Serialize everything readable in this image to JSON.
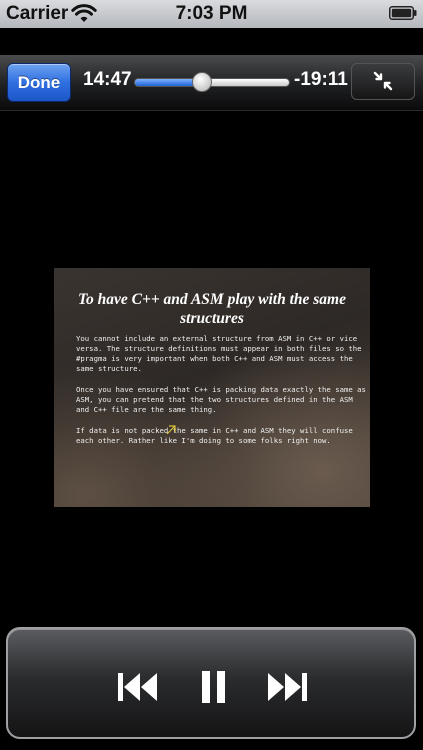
{
  "status_bar": {
    "carrier": "Carrier",
    "time": "7:03 PM",
    "wifi_icon": "wifi-icon",
    "battery_icon": "battery-icon"
  },
  "player": {
    "done_label": "Done",
    "elapsed": "14:47",
    "remaining": "-19:11",
    "progress_fraction": 0.435,
    "fullscreen_icon": "fullscreen-toggle-icon"
  },
  "slide": {
    "title": "To have C++ and ASM play with the same structures",
    "paragraphs": [
      "You cannot include an external structure from ASM in C++ or vice versa. The structure definitions must appear in both files so the #pragma is very important when both C++ and ASM must access the same structure.",
      "Once you have ensured that C++ is packing data exactly the same as ASM, you can pretend that the two structures defined in the ASM and C++ file are the same thing.",
      "If data is not packed the same in C++ and ASM they will confuse each other. Rather like I'm doing to some folks right now."
    ]
  },
  "transport": {
    "previous_icon": "previous-track-icon",
    "pause_icon": "pause-icon",
    "next_icon": "next-track-icon"
  },
  "colors": {
    "done_button": "#2f6fe0",
    "scrubber_fill": "#1e62d8"
  }
}
